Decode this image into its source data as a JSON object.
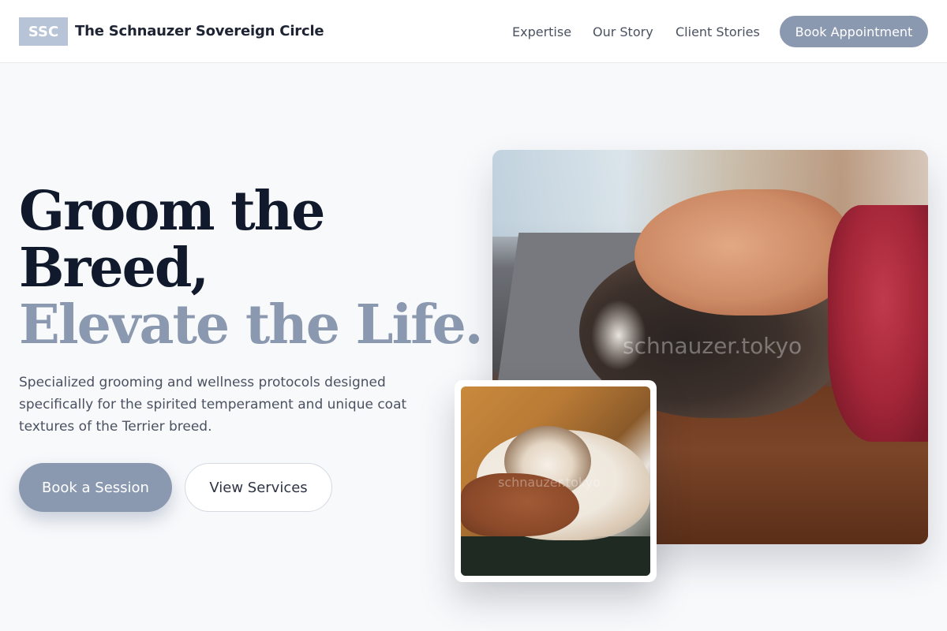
{
  "header": {
    "logo_text": "SSC",
    "brand_name": "The Schnauzer Sovereign Circle",
    "nav": [
      {
        "label": "Expertise"
      },
      {
        "label": "Our Story"
      },
      {
        "label": "Client Stories"
      }
    ],
    "cta_label": "Book Appointment"
  },
  "hero": {
    "headline_line1": "Groom the",
    "headline_line2": "Breed,",
    "headline_accent": "Elevate the Life.",
    "description": "Specialized grooming and wellness protocols designed specifically for the spirited temperament and unique coat textures of the Terrier breed.",
    "primary_button": "Book a Session",
    "secondary_button": "View Services"
  },
  "images": {
    "main_watermark": "schnauzer.tokyo",
    "small_watermark": "schnauzer.tokyo"
  },
  "colors": {
    "accent": "#8b99b0",
    "logo_bg": "#b7c3d6",
    "heading": "#111a2c",
    "body_text": "#4a5160",
    "page_bg": "#f8f9fb"
  }
}
